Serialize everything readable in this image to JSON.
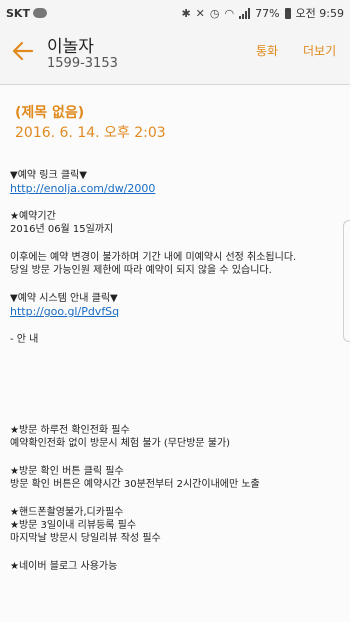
{
  "status_bar": {
    "carrier": "SKT",
    "battery": "77%",
    "time": "오전 9:59"
  },
  "header": {
    "contact_name": "이놀자",
    "contact_number": "1599-3153",
    "call_label": "통화",
    "more_label": "더보기"
  },
  "message": {
    "subject": "(제목 없음)",
    "date": "2016. 6. 14.  오후 2:03",
    "lines": {
      "l1": "▼예약 링크 클릭▼",
      "l2": "http://enolja.com/dw/2000",
      "l3": "★예약기간",
      "l4": "2016년 06월 15일까지",
      "l5": "이후에는 예약 변경이 불가하며 기간 내에 미예약시 선정 취소됩니다.",
      "l6": "당일 방문 가능인원 제한에 따라 예약이 되지 않을 수 있습니다.",
      "l7": "▼예약 시스템 안내 클릭▼",
      "l8": "http://goo.gl/PdvfSq",
      "l9": "- 안 내",
      "l10": "★방문 하루전 확인전화 필수",
      "l11": "예약확인전화 없이 방문시 체험 불가 (무단방문 불가)",
      "l12": "★방문 확인 버튼 클릭 필수",
      "l13": "방문 확인 버튼은 예약시간 30분전부터 2시간이내에만 노출",
      "l14": "★핸드폰촬영불가,디카필수",
      "l15": "★방문 3일이내 리뷰등록 필수",
      "l16": "마지막날 방문시 당일리뷰 작성 필수",
      "l17": "★네이버 블로그 사용가능"
    }
  }
}
